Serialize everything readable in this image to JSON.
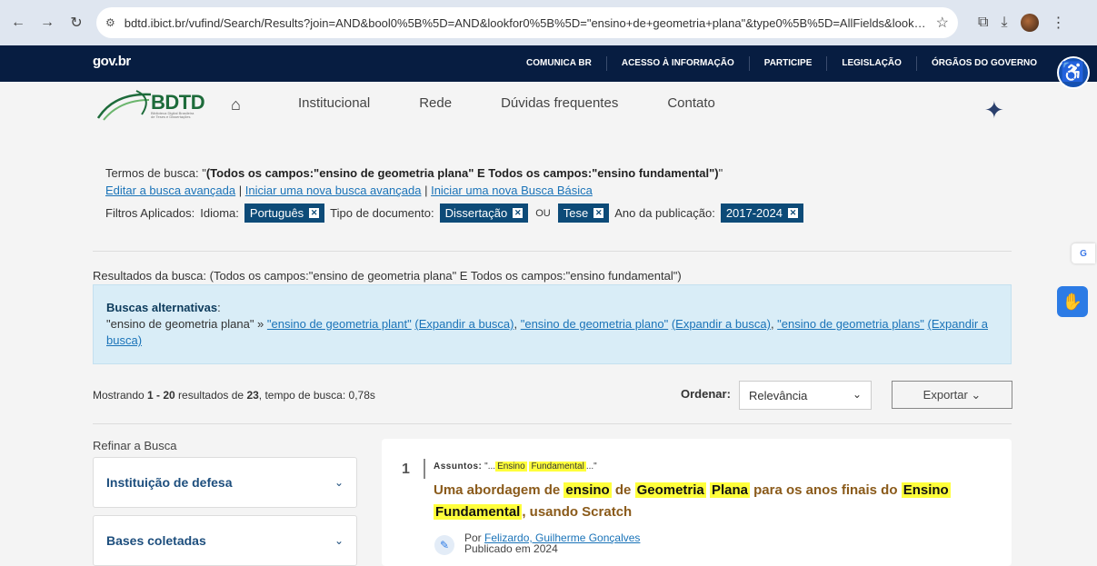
{
  "browser": {
    "url": "bdtd.ibict.br/vufind/Search/Results?join=AND&bool0%5B%5D=AND&lookfor0%5B%5D=\"ensino+de+geometria+plana\"&type0%5B%5D=AllFields&lookfor0..."
  },
  "govbar": {
    "logo": "gov.br",
    "links": [
      "COMUNICA BR",
      "ACESSO À INFORMAÇÃO",
      "PARTICIPE",
      "LEGISLAÇÃO",
      "ÓRGÃOS DO GOVERNO"
    ]
  },
  "header": {
    "logo_text": "BDTD",
    "logo_sub": "Biblioteca Digital Brasileira de Teses e Dissertações",
    "menu": [
      "Institucional",
      "Rede",
      "Dúvidas frequentes",
      "Contato"
    ]
  },
  "search": {
    "terms_label": "Termos de busca: \"",
    "terms_bold": "(Todos os campos:\"ensino de geometria plana\" E Todos os campos:\"ensino fundamental\")",
    "terms_end": "\"",
    "link_edit": "Editar a busca avançada",
    "link_new_adv": "Iniciar uma nova busca avançada",
    "link_new_basic": "Iniciar uma nova Busca Básica",
    "sep": "|",
    "filters_label": "Filtros Aplicados:",
    "idioma_label": "Idioma:",
    "idioma_value": "Português",
    "tipo_label": "Tipo de documento:",
    "tipo_value1": "Dissertação",
    "or_label": "OU",
    "tipo_value2": "Tese",
    "ano_label": "Ano da publicação:",
    "ano_value": "2017-2024"
  },
  "results_line": "Resultados da busca: (Todos os campos:\"ensino de geometria plana\" E Todos os campos:\"ensino fundamental\")",
  "alternatives": {
    "title": "Buscas alternativas",
    "original": "\"ensino de geometria plana\" » ",
    "alt1": "\"ensino de geometria plant\"",
    "alt2": "\"ensino de geometria plano\"",
    "alt3": "\"ensino de geometria plans\"",
    "expand": "(Expandir a busca)"
  },
  "showing": {
    "prefix": "Mostrando ",
    "range": "1 - 20",
    "mid": " resultados de ",
    "total": "23",
    "suffix": ", tempo de busca: 0,78s"
  },
  "order": {
    "label": "Ordenar:",
    "value": "Relevância",
    "export": "Exportar ⌄"
  },
  "refine": {
    "label": "Refinar a Busca",
    "facets": [
      "Instituição de defesa",
      "Bases coletadas"
    ]
  },
  "result1": {
    "num": "1",
    "subjects_label": "Assuntos:",
    "subjects_prefix": " \"...",
    "subject_w1": "Ensino",
    "subject_w2": "Fundamental",
    "subjects_suffix": "...\"",
    "title_p1": "Uma abordagem de ",
    "title_h1": "ensino",
    "title_p2": " de ",
    "title_h2": "Geometria",
    "title_h3": "Plana",
    "title_p3": " para os anos finais do ",
    "title_h4": "Ensino",
    "title_h5": "Fundamental",
    "title_p4": ", usando Scratch",
    "author_label": "Por ",
    "author": "Felizardo, Guilherme Gonçalves",
    "published": "Publicado em 2024"
  }
}
